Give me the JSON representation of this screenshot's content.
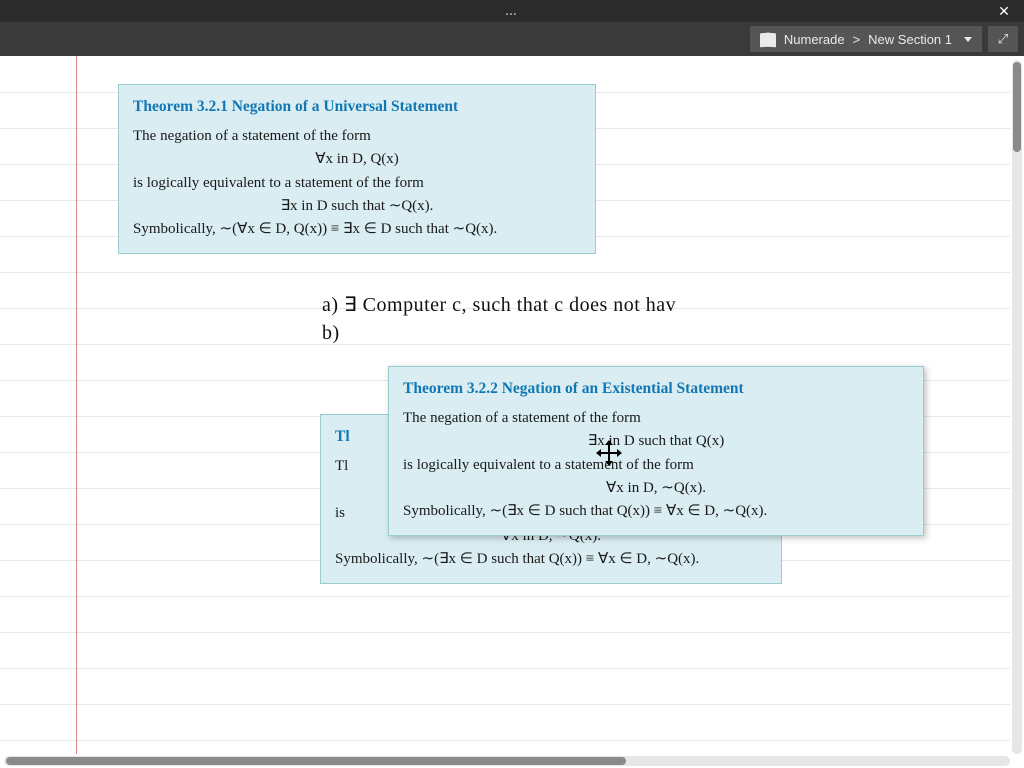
{
  "titlebar": {
    "dots": "…"
  },
  "toolbar": {
    "breadcrumb": {
      "app": "Numerade",
      "separator": ">",
      "section": "New Section 1"
    }
  },
  "theorem1": {
    "title": "Theorem 3.2.1 Negation of a Universal Statement",
    "line1": "The negation of a statement of the form",
    "formula1": "∀x in D, Q(x)",
    "line2": "is logically equivalent to a statement of the form",
    "formula2": "∃x in D such that ∼Q(x).",
    "symbolically": "Symbolically,   ∼(∀x ∈ D, Q(x)) ≡ ∃x ∈ D such that ∼Q(x)."
  },
  "theorem2_back": {
    "title_fragment": "Tl",
    "line1_fragment": "Tl",
    "line2_fragment": "is",
    "formula_peek": "∀x in D, ∼Q(x).",
    "symbolically": "Symbolically,   ∼(∃x ∈ D such that Q(x)) ≡ ∀x ∈ D, ∼Q(x)."
  },
  "theorem2_front": {
    "title": "Theorem 3.2.2 Negation of an Existential Statement",
    "line1": "The negation of a statement of the form",
    "formula1": "∃x in D such that Q(x)",
    "line2": "is logically equivalent to a statement of the form",
    "formula2": "∀x in D, ∼Q(x).",
    "symbolically": "Symbolically,   ∼(∃x ∈ D such that Q(x)) ≡ ∀x ∈ D, ∼Q(x)."
  },
  "handwriting": {
    "line_a": "a)   ∃ Computer c,  such that  c  does  not  hav",
    "line_b": "b)"
  }
}
